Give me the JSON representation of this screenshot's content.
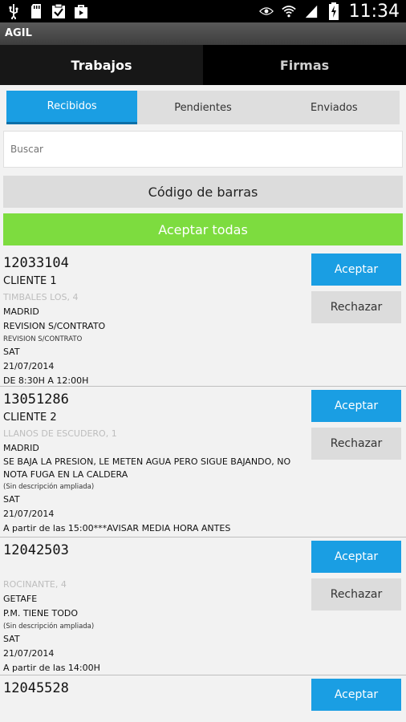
{
  "status_bar": {
    "time": "11:34",
    "left_icons": [
      "usb-icon",
      "sd-card-icon",
      "clipboard-check-icon",
      "bag-icon"
    ],
    "right_icons": [
      "eye-icon",
      "wifi-icon",
      "signal-icon",
      "battery-charging-icon"
    ]
  },
  "app": {
    "title": "AGIL"
  },
  "tabs": [
    {
      "label": "Trabajos",
      "active": true
    },
    {
      "label": "Firmas",
      "active": false
    }
  ],
  "segments": [
    {
      "label": "Recibidos",
      "active": true
    },
    {
      "label": "Pendientes",
      "active": false
    },
    {
      "label": "Enviados",
      "active": false
    }
  ],
  "search": {
    "placeholder": "Buscar",
    "value": ""
  },
  "barcode_label": "Código de barras",
  "accept_all_label": "Aceptar todas",
  "accept_label": "Aceptar",
  "reject_label": "Rechazar",
  "items": [
    {
      "number": "12033104",
      "client": "CLIENTE 1",
      "address": "TIMBALES LOS, 4",
      "city": "MADRID",
      "description": "REVISION S/CONTRATO",
      "extended": "REVISION S/CONTRATO",
      "type": "SAT",
      "date": "21/07/2014",
      "schedule": "DE 8:30H A 12:00H"
    },
    {
      "number": "13051286",
      "client": "CLIENTE 2",
      "address": "LLANOS DE ESCUDERO, 1",
      "city": "MADRID",
      "description": "SE BAJA LA PRESION, LE METEN AGUA PERO SIGUE BAJANDO, NO NOTA FUGA EN LA CALDERA",
      "extended": "(Sin descripción ampliada)",
      "type": "SAT",
      "date": "21/07/2014",
      "schedule": "A partir de las 15:00***AVISAR MEDIA HORA ANTES"
    },
    {
      "number": "12042503",
      "client": "",
      "address": "ROCINANTE, 4",
      "city": "GETAFE",
      "description": "P.M. TIENE TODO",
      "extended": "(Sin descripción ampliada)",
      "type": "SAT",
      "date": "21/07/2014",
      "schedule": "A partir de las 14:00H"
    },
    {
      "number": "12045528",
      "client": "",
      "address": "",
      "city": "",
      "description": "",
      "extended": "",
      "type": "",
      "date": "",
      "schedule": ""
    }
  ]
}
